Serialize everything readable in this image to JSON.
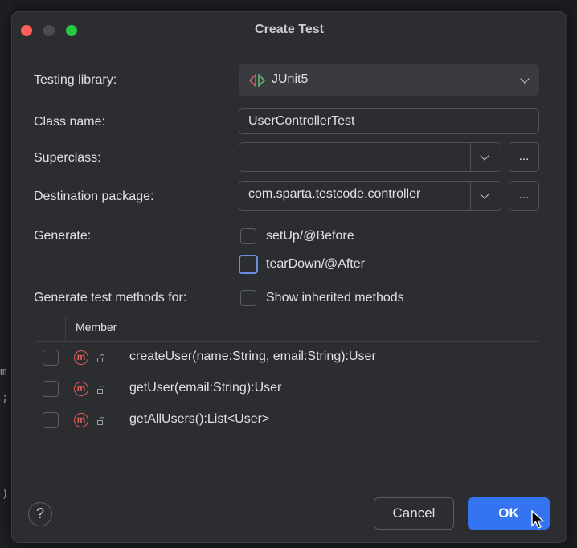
{
  "dialog": {
    "title": "Create Test",
    "testing_library": {
      "label": "Testing library:",
      "value": "JUnit5"
    },
    "class_name": {
      "label": "Class name:",
      "value": "UserControllerTest"
    },
    "superclass": {
      "label": "Superclass:",
      "value": "",
      "browse": "..."
    },
    "destination_package": {
      "label": "Destination package:",
      "value": "com.sparta.testcode.controller",
      "browse": "..."
    },
    "generate": {
      "label": "Generate:",
      "options": [
        {
          "label": "setUp/@Before",
          "checked": false
        },
        {
          "label": "tearDown/@After",
          "checked": false
        }
      ]
    },
    "test_methods": {
      "label": "Generate test methods for:",
      "show_inherited_label": "Show inherited methods",
      "column_header": "Member",
      "methods": [
        {
          "signature": "createUser(name:String, email:String):User",
          "checked": false
        },
        {
          "signature": "getUser(email:String):User",
          "checked": false
        },
        {
          "signature": "getAllUsers():List<User>",
          "checked": false
        }
      ]
    },
    "buttons": {
      "help": "?",
      "cancel": "Cancel",
      "ok": "OK"
    }
  },
  "background": {
    "glyphs": [
      "m",
      ";",
      ")"
    ]
  },
  "colors": {
    "accent": "#3574f0",
    "method_icon": "#db5c5c",
    "dialog_bg": "#2b2d30",
    "focus_border": "#6c8be8"
  },
  "icons": {
    "library": "junit-icon",
    "method": "method-icon",
    "access": "lock-icon",
    "dropdown": "chevron-down-icon"
  }
}
